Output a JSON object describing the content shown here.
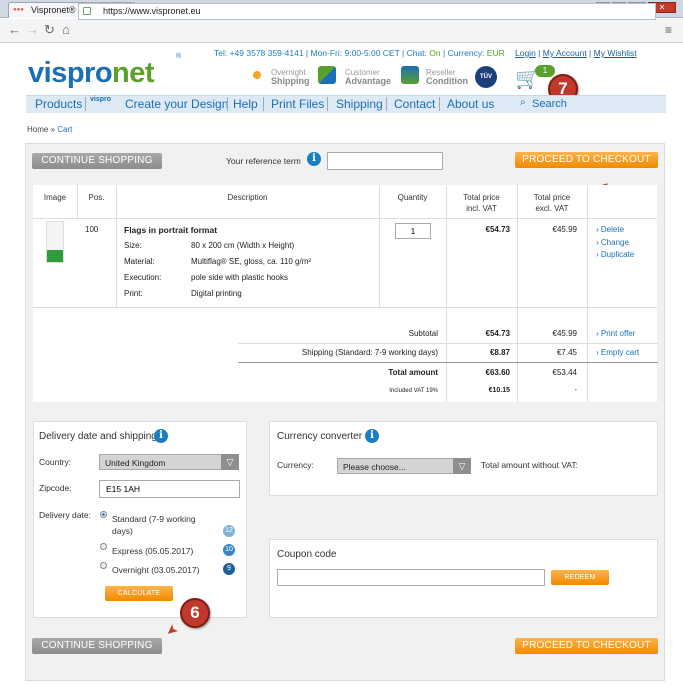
{
  "browser": {
    "tab_title": "Vispronet® – personalis",
    "url": "https://www.vispronet.eu"
  },
  "header": {
    "logo_text": "vispronet",
    "phone": "Tel: +49 3578 359-4141",
    "hours": "Mon-Fri: 9:00-5:00 CET",
    "chat_label": "Chat:",
    "chat_status": "On",
    "currency_label": "Currency:",
    "currency_value": "EUR",
    "login": "Login",
    "my_account": "My Account",
    "my_wishlist": "My Wishlist",
    "features": [
      {
        "line1": "Overnight",
        "line2": "Shipping"
      },
      {
        "line1": "Customer",
        "line2": "Advantage"
      },
      {
        "line1": "Reseller",
        "line2": "Condition"
      }
    ],
    "tuv": "TÜV",
    "cart_count": "1"
  },
  "nav": {
    "items": [
      "Products",
      "Create your Design",
      "Help",
      "Print Files",
      "Shipping",
      "Contact",
      "About us"
    ],
    "vispro_label": "vispro",
    "search_label": "Search"
  },
  "breadcrumb": {
    "home": "Home",
    "sep": "»",
    "current": "Cart"
  },
  "cart": {
    "continue_shopping": "CONTINUE SHOPPING",
    "reference_label": "Your reference term",
    "reference_value": "",
    "proceed_checkout": "PROCEED TO CHECKOUT",
    "columns": {
      "image": "Image",
      "pos": "Pos.",
      "description": "Description",
      "quantity": "Quantity",
      "total_incl_1": "Total price",
      "total_incl_2": "incl. VAT",
      "total_excl_1": "Total price",
      "total_excl_2": "excl. VAT"
    },
    "item": {
      "pos": "100",
      "title": "Flags in portrait format",
      "specs": [
        {
          "label": "Size:",
          "value": "80 x 200 cm (Width x Height)"
        },
        {
          "label": "Material:",
          "value": "Multiflag® SE, gloss, ca. 110 g/m²"
        },
        {
          "label": "Execution:",
          "value": "pole side with plastic hooks"
        },
        {
          "label": "Print:",
          "value": "Digital printing"
        }
      ],
      "quantity": "1",
      "total_incl": "€54.73",
      "total_excl": "€45.99",
      "actions": [
        "› Delete",
        "› Change",
        "› Duplicate"
      ]
    },
    "summary": {
      "subtotal_label": "Subtotal",
      "subtotal_incl": "€54.73",
      "subtotal_excl": "€45.99",
      "shipping_label": "Shipping (Standard: 7-9 working days)",
      "shipping_incl": "€8.87",
      "shipping_excl": "€7.45",
      "total_label": "Total amount",
      "total_incl": "€63.60",
      "total_excl": "€53.44",
      "vat_label": "Included VAT 19%",
      "vat_incl": "€10.15",
      "vat_excl": "-",
      "print_offer": "› Print offer",
      "empty_cart": "› Empty cart"
    }
  },
  "delivery": {
    "title": "Delivery date and shipping",
    "country_label": "Country:",
    "country_value": "United Kingdom",
    "zipcode_label": "Zipcode:",
    "zipcode_value": "E15 1AH",
    "date_label": "Delivery date:",
    "options": [
      {
        "label": "Standard (7-9 working",
        "label2": "days)",
        "days": "12",
        "color": "#7fb3d5",
        "selected": true
      },
      {
        "label": "Express (05.05.2017)",
        "label2": "",
        "days": "10",
        "color": "#3a87c2",
        "selected": false
      },
      {
        "label": "Overnight (03.05.2017)",
        "label2": "",
        "days": "9",
        "color": "#1f5f99",
        "selected": false
      }
    ],
    "calculate": "CALCULATE"
  },
  "currency_converter": {
    "title": "Currency converter",
    "currency_label": "Currency:",
    "select_value": "Please choose...",
    "total_label": "Total amount without VAT:"
  },
  "coupon": {
    "title": "Coupon code",
    "value": "",
    "redeem": "REDEEM"
  },
  "annotations": {
    "marker_6": "6",
    "marker_7": "7"
  },
  "colors": {
    "brand_blue": "#1a6fb5",
    "brand_green": "#5aa02c",
    "orange": "#f08a00",
    "marker_red": "#c0392b"
  }
}
